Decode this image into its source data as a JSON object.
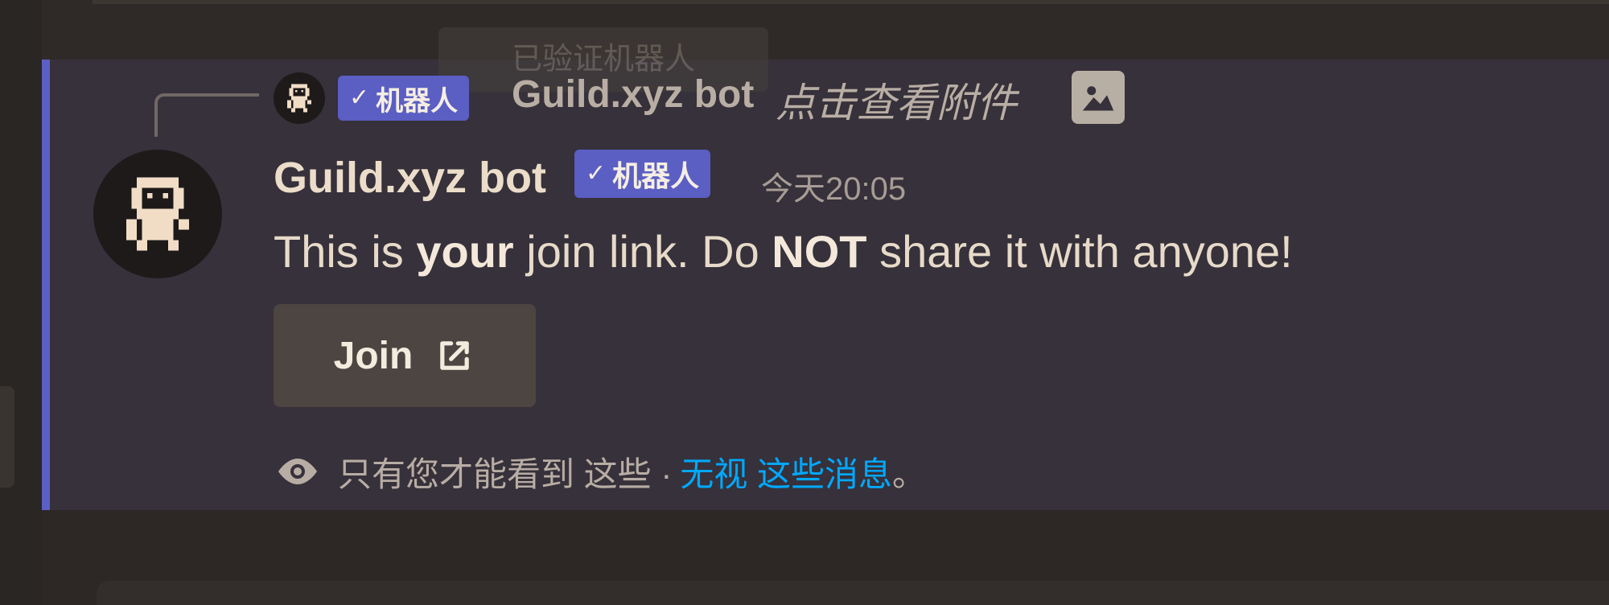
{
  "chat": {
    "background_tooltip": "已验证机器人",
    "reply": {
      "author": "Guild.xyz bot",
      "bot_tag": "机器人",
      "attachment_text": "点击查看附件"
    },
    "message": {
      "author": "Guild.xyz bot",
      "bot_tag": "机器人",
      "timestamp": "今天20:05",
      "content_parts": {
        "before_your": "This is ",
        "your": "your",
        "between": " join link. Do ",
        "not": "NOT",
        "after": " share it with anyone!"
      },
      "button": {
        "label": "Join"
      }
    },
    "ephemeral_notice": {
      "text": "只有您才能看到 这些 · ",
      "dismiss_link": "无视 这些消息",
      "ending": "。"
    }
  },
  "colors": {
    "accent_bar": "#5c5fc5",
    "bot_badge": "#5b5ec3",
    "link": "#00a8fc",
    "panel_background": "#36313a"
  },
  "icons": {
    "avatar": "robot-avatar-icon",
    "attachment": "image-icon",
    "button": "external-link-icon",
    "visibility": "eye-icon"
  }
}
